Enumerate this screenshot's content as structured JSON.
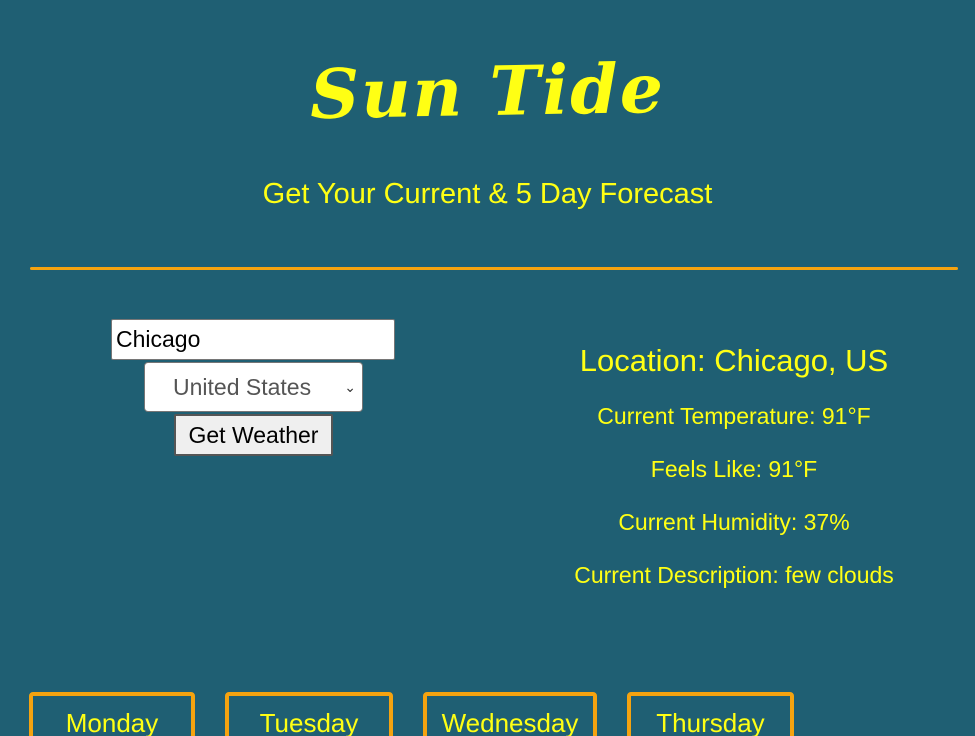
{
  "header": {
    "app_title": "Sun Tide",
    "subtitle": "Get Your Current & 5 Day Forecast"
  },
  "search": {
    "city_value": "Chicago",
    "country_selected": "United States",
    "button_label": "Get Weather"
  },
  "current": {
    "location": "Location: Chicago, US",
    "temperature": "Current Temperature: 91°F",
    "feels_like": "Feels Like: 91°F",
    "humidity": "Current Humidity: 37%",
    "description": "Current Description: few clouds"
  },
  "forecast": {
    "days": [
      "Monday",
      "Tuesday",
      "Wednesday",
      "Thursday"
    ]
  },
  "colors": {
    "background": "#1f5f73",
    "text": "#ffff14",
    "accent": "#f5a30f"
  }
}
